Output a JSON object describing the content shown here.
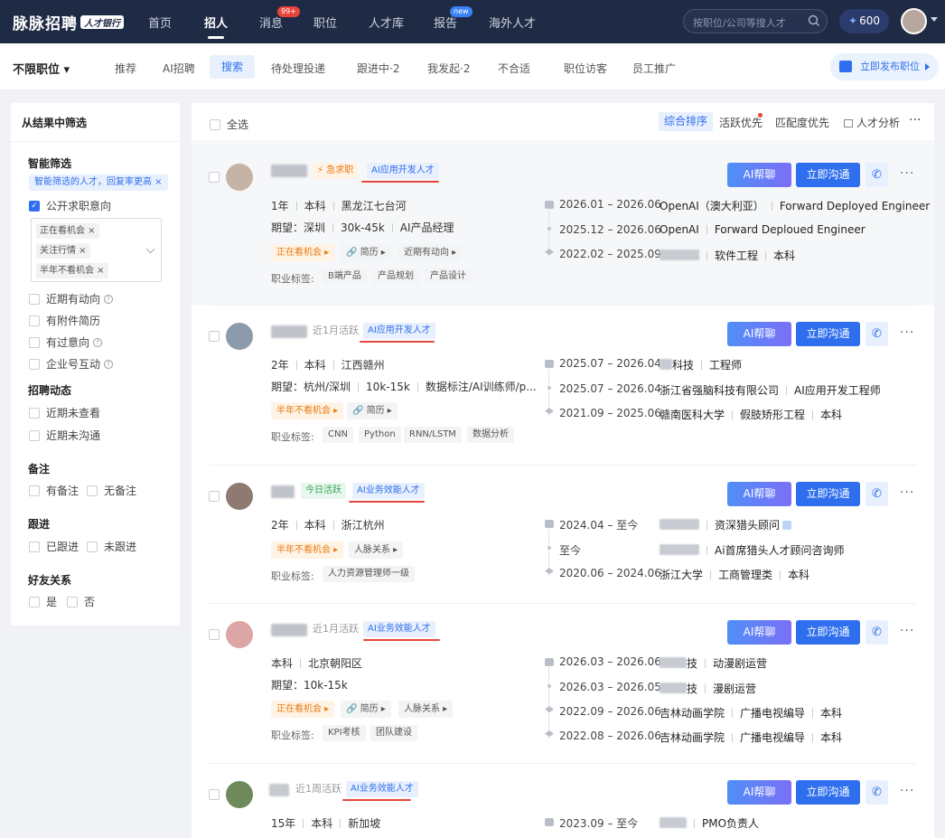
{
  "topbar": {
    "logo": "脉脉招聘",
    "logo_badge": "人才银行",
    "nav": [
      {
        "label": "首页"
      },
      {
        "label": "招人"
      },
      {
        "label": "消息",
        "badge": "99+"
      },
      {
        "label": "职位"
      },
      {
        "label": "人才库"
      },
      {
        "label": "报告",
        "badge": "new"
      },
      {
        "label": "海外人才"
      }
    ],
    "search_placeholder": "按职位/公司等搜人才",
    "coins": "600"
  },
  "subbar": {
    "position_select": "不限职位",
    "tabs": [
      "推荐",
      "AI招聘",
      "搜索",
      "待处理投递",
      "跟进中·2",
      "我发起·2",
      "不合适",
      "职位访客",
      "员工推广"
    ],
    "active_tab": "搜索",
    "publish_label": "立即发布职位"
  },
  "sidebar": {
    "title": "从结果中筛选",
    "smart": {
      "heading": "智能筛选",
      "tag": "智能筛选的人才，回复率更高 ×",
      "public_intent": "公开求职意向",
      "selected": [
        "正在看机会 ×",
        "关注行情 ×",
        "半年不看机会 ×"
      ],
      "options": [
        "近期有动向",
        "有附件简历",
        "有过意向",
        "企业号互动"
      ]
    },
    "dynamics": {
      "heading": "招聘动态",
      "options": [
        "近期未查看",
        "近期未沟通"
      ]
    },
    "notes": {
      "heading": "备注",
      "options": [
        "有备注",
        "无备注"
      ]
    },
    "follow": {
      "heading": "跟进",
      "options": [
        "已跟进",
        "未跟进"
      ]
    },
    "friend": {
      "heading": "好友关系",
      "options": [
        "是",
        "否"
      ]
    }
  },
  "listhead": {
    "select_all": "全选",
    "sort": [
      "综合排序",
      "活跃优先",
      "匹配度优先",
      "人才分析"
    ],
    "active_sort": "综合排序"
  },
  "buttons": {
    "ai_chat": "AI帮聊",
    "contact": "立即沟通",
    "phone": "✆",
    "more": "···"
  },
  "cards": [
    {
      "status_tag": "⚡ 急求职",
      "ai_tag": "AI应用开发人才",
      "line1": [
        "1年",
        "本科",
        "黑龙江七台河"
      ],
      "line2": [
        "期望：深圳",
        "30k-45k",
        "AI产品经理"
      ],
      "chips": [
        "正在看机会 ▸",
        "🔗 简历 ▸",
        "近期有动向 ▸"
      ],
      "skills_label": "职业标签:",
      "skills": [
        "B端产品",
        "产品规划",
        "产品设计"
      ],
      "timeline": [
        {
          "date": "2026.01 – 2026.06",
          "org": "OpenAI（澳大利亚）",
          "role": "Forward Deployed Engineer"
        },
        {
          "date": "2025.12 – 2026.06",
          "org": "OpenAI",
          "role": "Forward Deploued Engineer"
        },
        {
          "date": "2022.02 – 2025.09",
          "org": "",
          "role": "软件工程",
          "degree": "本科"
        }
      ]
    },
    {
      "status_tag": "近1月活跃",
      "ai_tag": "AI应用开发人才",
      "line1": [
        "2年",
        "本科",
        "江西赣州"
      ],
      "line2": [
        "期望：杭州/深圳",
        "10k-15k",
        "数据标注/AI训练师/p..."
      ],
      "chips": [
        "半年不看机会 ▸",
        "🔗 简历 ▸"
      ],
      "skills_label": "职业标签:",
      "skills": [
        "CNN",
        "Python",
        "RNN/LSTM",
        "数据分析"
      ],
      "timeline": [
        {
          "date": "2025.07 – 2026.04",
          "org": "科技",
          "role": "工程师"
        },
        {
          "date": "2025.07 – 2026.04",
          "org": "浙江省强脑科技有限公司",
          "role": "AI应用开发工程师"
        },
        {
          "date": "2021.09 – 2025.06",
          "org": "赣南医科大学",
          "role": "假肢矫形工程",
          "degree": "本科"
        }
      ]
    },
    {
      "status_tag": "今日活跃",
      "ai_tag": "AI业务效能人才",
      "line1": [
        "2年",
        "本科",
        "浙江杭州"
      ],
      "line2": [],
      "chips": [
        "半年不看机会 ▸",
        "人脉关系 ▸"
      ],
      "skills_label": "职业标签:",
      "skills": [
        "人力资源管理师一级"
      ],
      "timeline": [
        {
          "date": "2024.04 – 至今",
          "org": "",
          "role": "资深猎头顾问"
        },
        {
          "date": "至今",
          "org": "",
          "role": "Ai首席猎头人才顾问咨询师"
        },
        {
          "date": "2020.06 – 2024.06",
          "org": "浙江大学",
          "role": "工商管理类",
          "degree": "本科"
        }
      ]
    },
    {
      "status_tag": "近1月活跃",
      "ai_tag": "AI业务效能人才",
      "line1": [
        "本科",
        "北京朝阳区"
      ],
      "line2": [
        "期望：10k-15k"
      ],
      "chips": [
        "正在看机会 ▸",
        "🔗 简历 ▸",
        "人脉关系 ▸"
      ],
      "skills_label": "职业标签:",
      "skills": [
        "KPI考核",
        "团队建设"
      ],
      "timeline": [
        {
          "date": "2026.03 – 2026.06",
          "org": "技",
          "role": "动漫剧运营"
        },
        {
          "date": "2026.03 – 2026.05",
          "org": "技",
          "role": "漫剧运营"
        },
        {
          "date": "2022.09 – 2026.06",
          "org": "吉林动画学院",
          "role": "广播电视编导",
          "degree": "本科"
        },
        {
          "date": "2022.08 – 2026.06",
          "org": "吉林动画学院",
          "role": "广播电视编导",
          "degree": "本科"
        }
      ]
    },
    {
      "status_tag": "近1周活跃",
      "ai_tag": "AI业务效能人才",
      "line1": [
        "15年",
        "本科",
        "新加坡"
      ],
      "line2": [],
      "chips": [],
      "skills_label": "",
      "skills": [],
      "timeline": [
        {
          "date": "2023.09 – 至今",
          "org": "",
          "role": "PMO负责人"
        }
      ]
    }
  ]
}
